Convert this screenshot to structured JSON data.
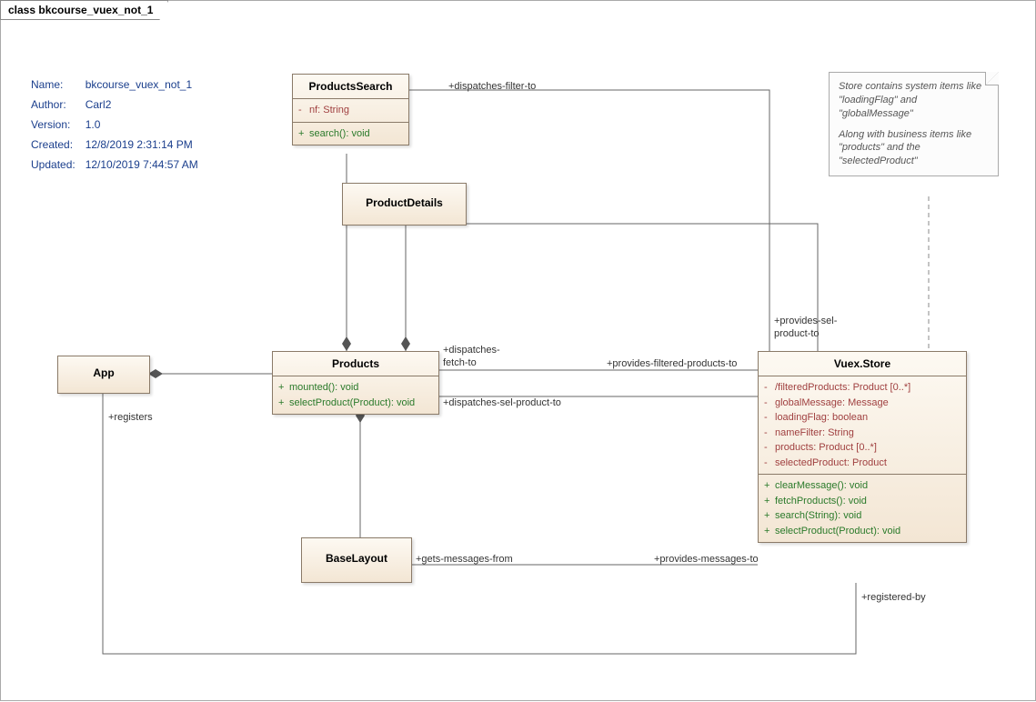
{
  "diagram": {
    "title": "class bkcourse_vuex_not_1",
    "meta": {
      "name_label": "Name:",
      "name": "bkcourse_vuex_not_1",
      "author_label": "Author:",
      "author": "Carl2",
      "version_label": "Version:",
      "version": "1.0",
      "created_label": "Created:",
      "created": "12/8/2019 2:31:14 PM",
      "updated_label": "Updated:",
      "updated": "12/10/2019 7:44:57 AM"
    },
    "note": {
      "line1": "Store contains system items like \"loadingFlag\" and \"globalMessage\"",
      "line2": "Along with business items like \"products\" and the \"selectedProduct\""
    },
    "classes": {
      "ProductsSearch": {
        "title": "ProductsSearch",
        "attrs": [
          {
            "vis": "-",
            "text": "nf: String"
          }
        ],
        "ops": [
          {
            "vis": "+",
            "text": "search(): void"
          }
        ]
      },
      "ProductDetails": {
        "title": "ProductDetails"
      },
      "App": {
        "title": "App"
      },
      "Products": {
        "title": "Products",
        "ops": [
          {
            "vis": "+",
            "text": "mounted(): void"
          },
          {
            "vis": "+",
            "text": "selectProduct(Product): void"
          }
        ]
      },
      "BaseLayout": {
        "title": "BaseLayout"
      },
      "VuexStore": {
        "title": "Vuex.Store",
        "attrs": [
          {
            "vis": "-",
            "text": "/filteredProducts: Product [0..*]"
          },
          {
            "vis": "-",
            "text": "globalMessage: Message"
          },
          {
            "vis": "-",
            "text": "loadingFlag: boolean"
          },
          {
            "vis": "-",
            "text": "nameFilter: String"
          },
          {
            "vis": "-",
            "text": "products: Product [0..*]"
          },
          {
            "vis": "-",
            "text": "selectedProduct: Product"
          }
        ],
        "ops": [
          {
            "vis": "+",
            "text": "clearMessage(): void"
          },
          {
            "vis": "+",
            "text": "fetchProducts(): void"
          },
          {
            "vis": "+",
            "text": "search(String): void"
          },
          {
            "vis": "+",
            "text": "selectProduct(Product): void"
          }
        ]
      }
    },
    "labels": {
      "dispatchesFilterTo": "+dispatches-filter-to",
      "dispatchesFetchTo1": "+dispatches-",
      "dispatchesFetchTo2": "fetch-to",
      "providesFilteredProductsTo": "+provides-filtered-products-to",
      "dispatchesSelProductTo": "+dispatches-sel-product-to",
      "providesSelProductTo1": "+provides-sel-",
      "providesSelProductTo2": "product-to",
      "getsMessagesFrom": "+gets-messages-from",
      "providesMessagesTo": "+provides-messages-to",
      "registers": "+registers",
      "registeredBy": "+registered-by"
    }
  },
  "chart_data": {
    "type": "uml-class-diagram",
    "classes": [
      {
        "name": "App"
      },
      {
        "name": "ProductsSearch",
        "attributes": [
          "- nf: String"
        ],
        "operations": [
          "+ search(): void"
        ]
      },
      {
        "name": "ProductDetails"
      },
      {
        "name": "Products",
        "operations": [
          "+ mounted(): void",
          "+ selectProduct(Product): void"
        ]
      },
      {
        "name": "BaseLayout"
      },
      {
        "name": "Vuex.Store",
        "attributes": [
          "- /filteredProducts: Product [0..*]",
          "- globalMessage: Message",
          "- loadingFlag: boolean",
          "- nameFilter: String",
          "- products: Product [0..*]",
          "- selectedProduct: Product"
        ],
        "operations": [
          "+ clearMessage(): void",
          "+ fetchProducts(): void",
          "+ search(String): void",
          "+ selectProduct(Product): void"
        ]
      }
    ],
    "relationships": [
      {
        "from": "App",
        "to": "Products",
        "type": "composition"
      },
      {
        "from": "Products",
        "to": "ProductsSearch",
        "type": "composition"
      },
      {
        "from": "Products",
        "to": "ProductDetails",
        "type": "composition"
      },
      {
        "from": "Products",
        "to": "BaseLayout",
        "type": "composition"
      },
      {
        "from": "ProductsSearch",
        "to": "Vuex.Store",
        "type": "association",
        "sourceRole": "+dispatches-filter-to"
      },
      {
        "from": "ProductDetails",
        "to": "Vuex.Store",
        "type": "association",
        "targetRole": "+provides-sel-product-to"
      },
      {
        "from": "Products",
        "to": "Vuex.Store",
        "type": "association",
        "sourceRole": "+dispatches-fetch-to",
        "targetRole": "+provides-filtered-products-to"
      },
      {
        "from": "Products",
        "to": "Vuex.Store",
        "type": "association",
        "sourceRole": "+dispatches-sel-product-to"
      },
      {
        "from": "BaseLayout",
        "to": "Vuex.Store",
        "type": "association",
        "sourceRole": "+gets-messages-from",
        "targetRole": "+provides-messages-to"
      },
      {
        "from": "App",
        "to": "Vuex.Store",
        "type": "association",
        "sourceRole": "+registers",
        "targetRole": "+registered-by"
      },
      {
        "from": "Note",
        "to": "Vuex.Store",
        "type": "note-link"
      }
    ]
  }
}
